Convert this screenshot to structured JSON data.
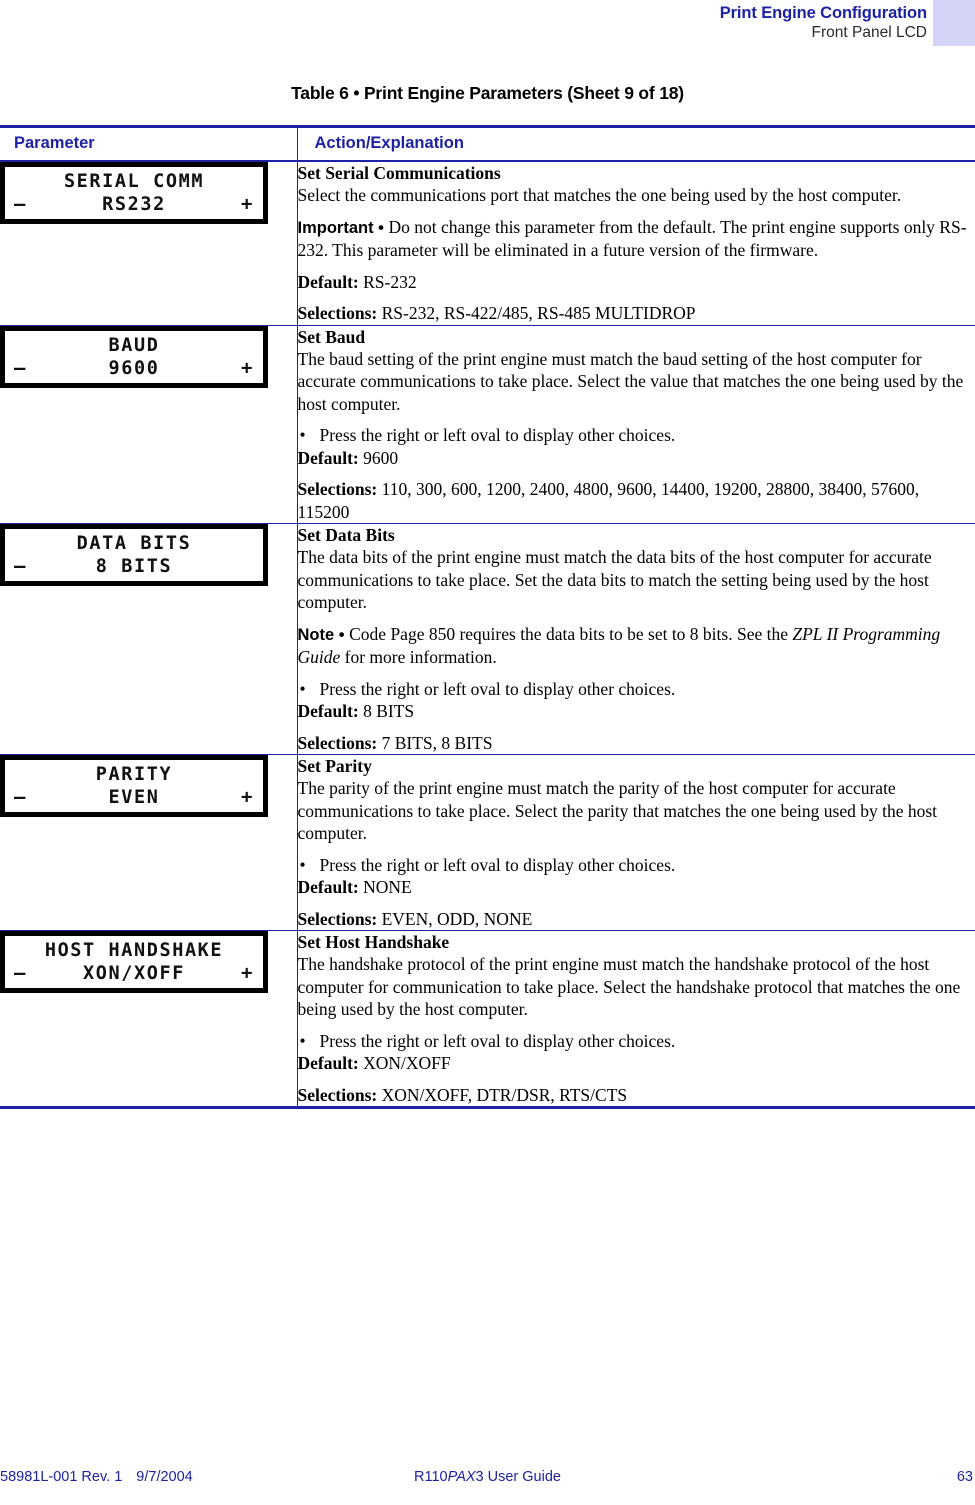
{
  "header": {
    "title": "Print Engine Configuration",
    "subtitle": "Front Panel LCD",
    "accent_color": "#d6d3f8",
    "title_color": "#1d22a5"
  },
  "table_title": "Table 6 • Print Engine Parameters (Sheet 9 of 18)",
  "table": {
    "columns": [
      "Parameter",
      "Action/Explanation"
    ],
    "border_color": "#1d22a5",
    "rows": [
      {
        "lcd": {
          "line1": "SERIAL COMM",
          "line2": "RS232",
          "minus": "–",
          "plus": "+",
          "has_plus": true
        },
        "heading": "Set Serial Communications",
        "body": "Select the communications port that matches the one being used by the host computer.",
        "note_label": "Important • ",
        "note_label_style": "sans",
        "note_text": "Do not change this parameter from the default. The print engine supports only RS-232. This parameter will be eliminated in a future version of the firmware.",
        "bullet": null,
        "default_label": "Default:",
        "default_value": "RS-232",
        "selections_label": "Selections:",
        "selections_value": "RS-232, RS-422/485, RS-485 MULTIDROP"
      },
      {
        "lcd": {
          "line1": "BAUD",
          "line2": "9600",
          "minus": "–",
          "plus": "+",
          "has_plus": true
        },
        "heading": "Set Baud",
        "body": "The baud setting of the print engine must match the baud setting of the host computer for accurate communications to take place. Select the value that matches the one being used by the host computer.",
        "note_label": null,
        "note_text": null,
        "bullet": "Press the right or left oval to display other choices.",
        "default_label": "Default:",
        "default_value": "9600",
        "selections_label": "Selections:",
        "selections_value": "110, 300, 600, 1200, 2400, 4800, 9600, 14400, 19200, 28800, 38400, 57600, 115200"
      },
      {
        "lcd": {
          "line1": "DATA BITS",
          "line2": "8 BITS",
          "minus": "–",
          "plus": "",
          "has_plus": false
        },
        "heading": "Set Data Bits",
        "body": "The data bits of the print engine must match the data bits of the host computer for accurate communications to take place. Set the data bits to match the setting being used by the host computer.",
        "note_label": "Note • ",
        "note_label_style": "sans",
        "note_text": "Code Page 850 requires the data bits to be set to 8 bits. See the ",
        "note_italic": "ZPL II Programming Guide",
        "note_text_tail": " for more information.",
        "bullet": "Press the right or left oval to display other choices.",
        "default_label": "Default:",
        "default_value": "8 BITS",
        "selections_label": "Selections:",
        "selections_value": "7 BITS, 8 BITS"
      },
      {
        "lcd": {
          "line1": "PARITY",
          "line2": "EVEN",
          "minus": "–",
          "plus": "+",
          "has_plus": true
        },
        "heading": "Set Parity",
        "body": "The parity of the print engine must match the parity of the host computer for accurate communications to take place. Select the parity that matches the one being used by the host computer.",
        "note_label": null,
        "note_text": null,
        "bullet": "Press the right or left oval to display other choices.",
        "default_label": "Default:",
        "default_value": "NONE",
        "selections_label": "Selections:",
        "selections_value": "EVEN, ODD, NONE"
      },
      {
        "lcd": {
          "line1": "HOST HANDSHAKE",
          "line2": "XON/XOFF",
          "minus": "–",
          "plus": "+",
          "has_plus": true
        },
        "heading": "Set Host Handshake",
        "body": "The handshake protocol of the print engine must match the handshake protocol of the host computer for communication to take place. Select the handshake protocol that matches the one being used by the host computer.",
        "note_label": null,
        "note_text": null,
        "bullet": "Press the right or left oval to display other choices.",
        "default_label": "Default:",
        "default_value": "XON/XOFF",
        "selections_label": "Selections:",
        "selections_value": "XON/XOFF, DTR/DSR, RTS/CTS"
      }
    ]
  },
  "footer": {
    "doc_number": "58981L-001 Rev. 1",
    "date": "9/7/2004",
    "guide_prefix": "R110",
    "guide_italic": "PAX",
    "guide_suffix": "3 User Guide",
    "page_number": "63"
  }
}
